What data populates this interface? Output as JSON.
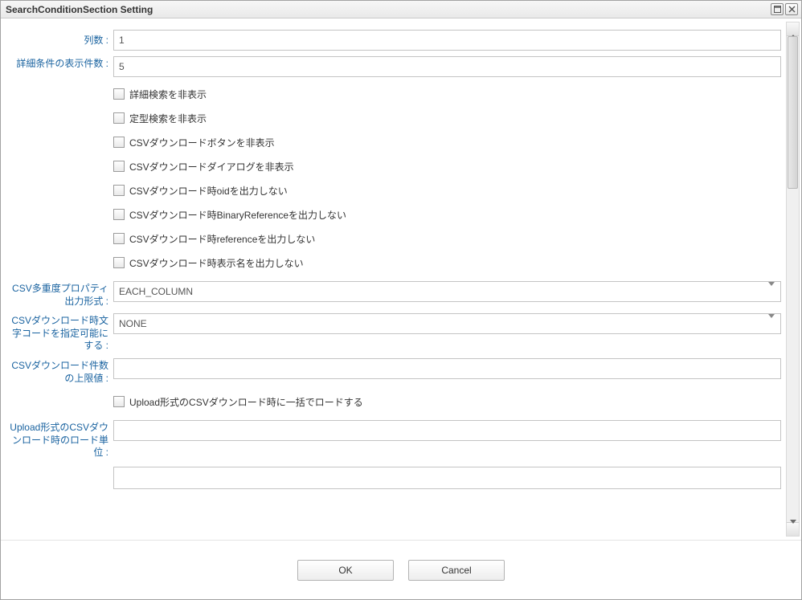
{
  "window": {
    "title": "SearchConditionSection Setting"
  },
  "form": {
    "columnCount": {
      "label": "列数 :",
      "value": "1"
    },
    "conditionDisplayCount": {
      "label": "詳細条件の表示件数 :",
      "value": "5"
    },
    "checkboxes": {
      "hideDetailSearch": "詳細検索を非表示",
      "hideFixedSearch": "定型検索を非表示",
      "hideCsvDownloadButton": "CSVダウンロードボタンを非表示",
      "hideCsvDownloadDialog": "CSVダウンロードダイアログを非表示",
      "noCsvOid": "CSVダウンロード時oidを出力しない",
      "noCsvBinaryReference": "CSVダウンロード時BinaryReferenceを出力しない",
      "noCsvReference": "CSVダウンロード時referenceを出力しない",
      "noCsvDisplayName": "CSVダウンロード時表示名を出力しない"
    },
    "csvMultiplicityFormat": {
      "label": "CSV多重度プロパティ出力形式 :",
      "value": "EACH_COLUMN"
    },
    "csvDownloadCharset": {
      "label": "CSVダウンロード時文字コードを指定可能にする :",
      "value": "NONE"
    },
    "csvDownloadLimit": {
      "label": "CSVダウンロード件数の上限値 :",
      "value": ""
    },
    "uploadCsvBatchLoad": {
      "label": "Upload形式のCSVダウンロード時に一括でロードする"
    },
    "uploadCsvLoadUnit": {
      "label": "Upload形式のCSVダウンロード時のロード単位 :",
      "value": ""
    }
  },
  "buttons": {
    "ok": "OK",
    "cancel": "Cancel"
  }
}
